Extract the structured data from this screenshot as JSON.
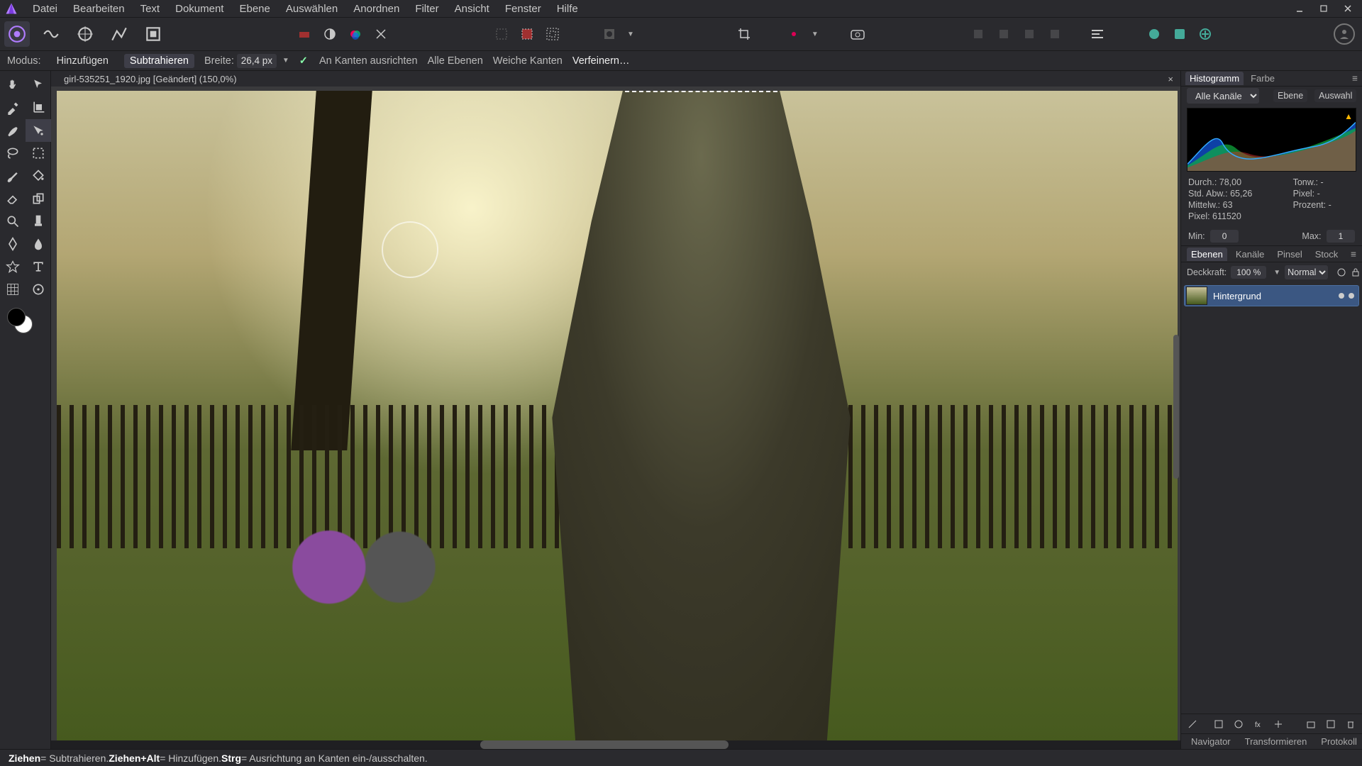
{
  "menu": [
    "Datei",
    "Bearbeiten",
    "Text",
    "Dokument",
    "Ebene",
    "Auswählen",
    "Anordnen",
    "Filter",
    "Ansicht",
    "Fenster",
    "Hilfe"
  ],
  "context": {
    "modus_label": "Modus:",
    "mode_add": "Hinzufügen",
    "mode_subtract": "Subtrahieren",
    "width_label": "Breite:",
    "width_value": "26,4 px",
    "snap_edges": "An Kanten ausrichten",
    "all_layers": "Alle Ebenen",
    "soft_edges": "Weiche Kanten",
    "refine": "Verfeinern…"
  },
  "document": {
    "tab_title": "girl-535251_1920.jpg [Geändert] (150,0%)"
  },
  "histogram": {
    "tabs": {
      "histogram": "Histogramm",
      "farbe": "Farbe"
    },
    "channel_options": [
      "Alle Kanäle"
    ],
    "ebene_btn": "Ebene",
    "auswahl_btn": "Auswahl",
    "stats": {
      "durch": "Durch.: 78,00",
      "stdabw": "Std. Abw.: 65,26",
      "mittelw": "Mittelw.: 63",
      "pixel": "Pixel: 611520",
      "tonw": "Tonw.: -",
      "pixel2": "Pixel: -",
      "prozent": "Prozent: -"
    },
    "min_label": "Min:",
    "min_value": "0",
    "max_label": "Max:",
    "max_value": "1"
  },
  "layers_panel": {
    "tabs": {
      "ebenen": "Ebenen",
      "kanale": "Kanäle",
      "pinsel": "Pinsel",
      "stock": "Stock"
    },
    "opacity_label": "Deckkraft:",
    "opacity_value": "100 %",
    "blend_mode": "Normal",
    "layers": [
      {
        "name": "Hintergrund"
      }
    ]
  },
  "footer_panel": {
    "tabs": {
      "navigator": "Navigator",
      "transform": "Transformieren",
      "protokoll": "Protokoll"
    }
  },
  "status": {
    "drag": "Ziehen",
    "t1": " = Subtrahieren. ",
    "dragalt": "Ziehen+Alt",
    "t2": " = Hinzufügen. ",
    "ctrl": "Strg",
    "t3": " = Ausrichtung an Kanten ein-/ausschalten."
  }
}
